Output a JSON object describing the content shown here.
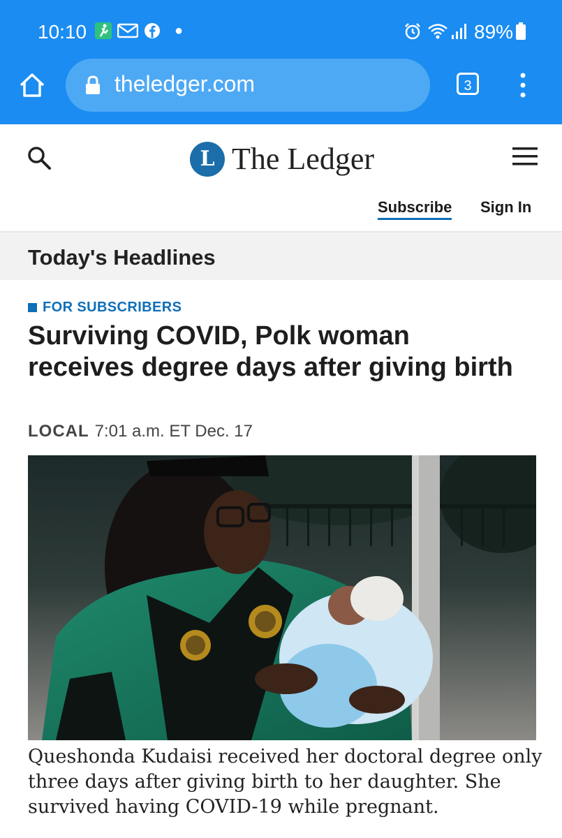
{
  "status_bar": {
    "time": "10:10",
    "battery": "89%",
    "notification_icons": [
      "fitness-icon",
      "mail-icon",
      "facebook-icon"
    ],
    "system_icons": [
      "alarm-icon",
      "wifi-icon",
      "signal-icon",
      "battery-icon"
    ]
  },
  "browser": {
    "url": "theledger.com",
    "tab_count": "3"
  },
  "site": {
    "logo_letter": "L",
    "name": "The Ledger",
    "subscribe": "Subscribe",
    "sign_in": "Sign In"
  },
  "section": {
    "title": "Today's Headlines"
  },
  "article": {
    "kicker": "FOR SUBSCRIBERS",
    "headline": "Surviving COVID, Polk woman receives degree days after giving birth",
    "category": "LOCAL",
    "timestamp": "7:01 a.m. ET Dec. 17",
    "caption": "Queshonda Kudaisi received her doctoral degree only three days after giving birth to her daughter. She survived having COVID-19 while pregnant."
  },
  "colors": {
    "browser_blue": "#1a8cf2",
    "brand_blue": "#1b6ea9",
    "link_blue": "#0f6fb8"
  }
}
